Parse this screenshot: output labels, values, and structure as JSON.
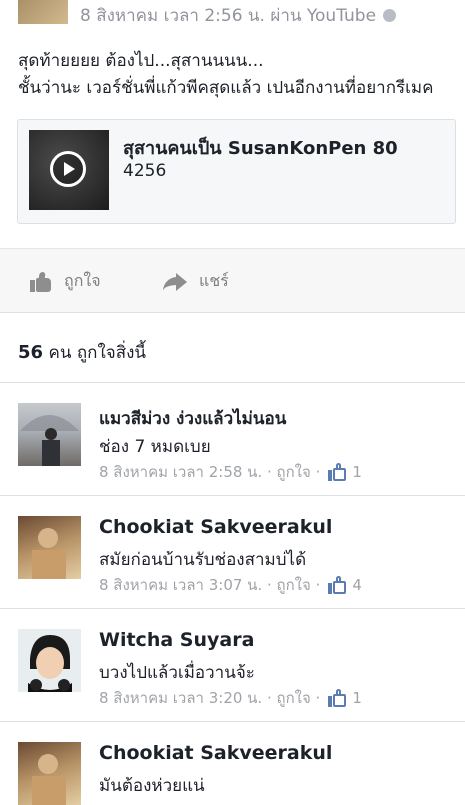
{
  "post": {
    "meta": "8 สิงหาคม เวลา 2:56 น. ผ่าน YouTube",
    "text_line1": "สุดท้ายยยย ต้องไป...สุสานนนน...",
    "text_line2": "ชั้นว่านะ เวอร์ชั่นพี่แก้วพีคสุดแล้ว เปนอีกงานที่อยากรีเมค",
    "video": {
      "title": "สุสานคนเป็น SusanKonPen 80",
      "subtitle": "4256"
    }
  },
  "actions": {
    "like_label": "ถูกใจ",
    "share_label": "แชร์"
  },
  "likes_summary": {
    "count": "56",
    "text": "คน ถูกใจสิ่งนี้"
  },
  "comments": [
    {
      "name": "แมวสีม่วง ง่วงแล้วไม่นอน",
      "text": "ช่อง 7 หมดเบย",
      "meta": "8 สิงหาคม เวลา 2:58 น. · ถูกใจ ·",
      "likes": "1"
    },
    {
      "name": "Chookiat Sakveerakul",
      "text": "สมัยก่อนบ้านรับช่องสามบ่ได้",
      "meta": "8 สิงหาคม เวลา 3:07 น. · ถูกใจ ·",
      "likes": "4"
    },
    {
      "name": "Witcha Suyara",
      "text": "บวงไปแล้วเมื่อวานจ้ะ",
      "meta": "8 สิงหาคม เวลา 3:20 น. · ถูกใจ ·",
      "likes": "1"
    },
    {
      "name": "Chookiat Sakveerakul",
      "text": "มันต้องห่วยแน่",
      "meta": "",
      "likes": ""
    }
  ],
  "colors": {
    "text": "#1d2129",
    "muted": "#90949c",
    "link_blue": "#5b7bb3",
    "actions_bg": "#f7f7f7"
  },
  "icons": [
    "globe-icon",
    "play-icon",
    "like-icon",
    "share-icon",
    "comment-like-icon"
  ]
}
